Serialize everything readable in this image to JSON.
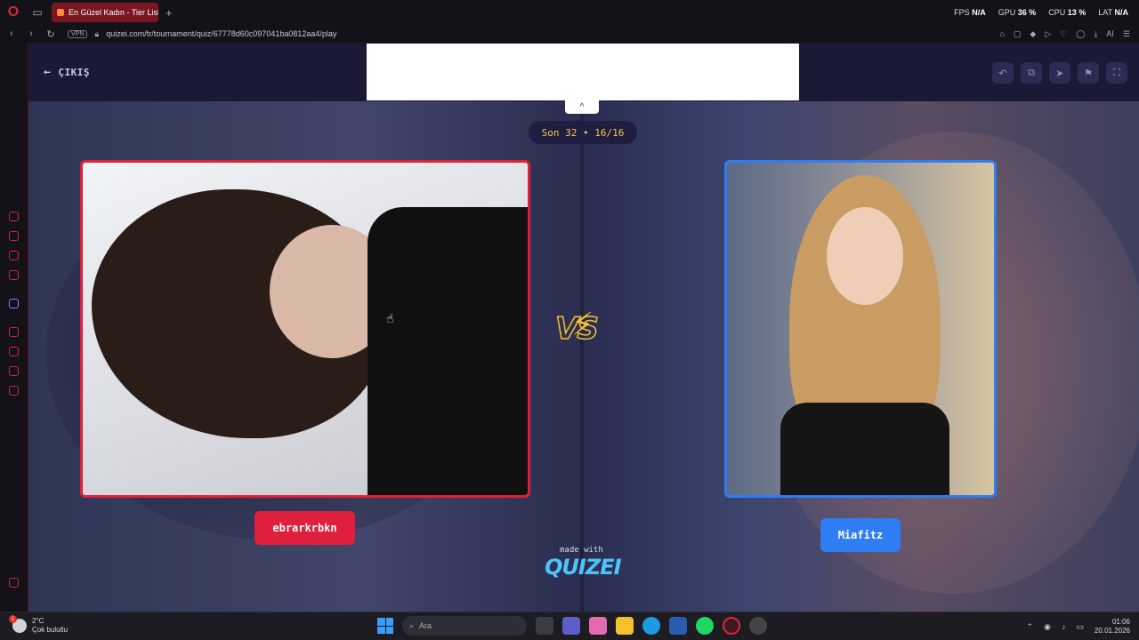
{
  "browser": {
    "tab_title": "En Güzel Kadın - Tier List,",
    "new_tab": "+",
    "stats": [
      {
        "label": "FPS",
        "value": "N/A"
      },
      {
        "label": "GPU",
        "value": "36 %"
      },
      {
        "label": "CPU",
        "value": "13 %"
      },
      {
        "label": "LAT",
        "value": "N/A"
      }
    ],
    "vpn_label": "VPN",
    "url": "quizei.com/tr/tournament/quiz/67778d60c097041ba0812aa4/play",
    "ai_label": "AI"
  },
  "page": {
    "exit_label": "ÇIKIŞ",
    "ad_toggle": "^",
    "round": "Son 32 • 16/16",
    "vs_label": "VS",
    "left_name": "ebrarkrbkn",
    "right_name": "Miafitz",
    "made_with": "made with",
    "brand": "QUIZEI",
    "accent_left": "#e01f3d",
    "accent_right": "#2f7df3"
  },
  "taskbar": {
    "temperature": "2°C",
    "weather_text": "Çok bulutlu",
    "search_placeholder": "Ara",
    "time": "01:06",
    "date": "20.01.2026"
  }
}
